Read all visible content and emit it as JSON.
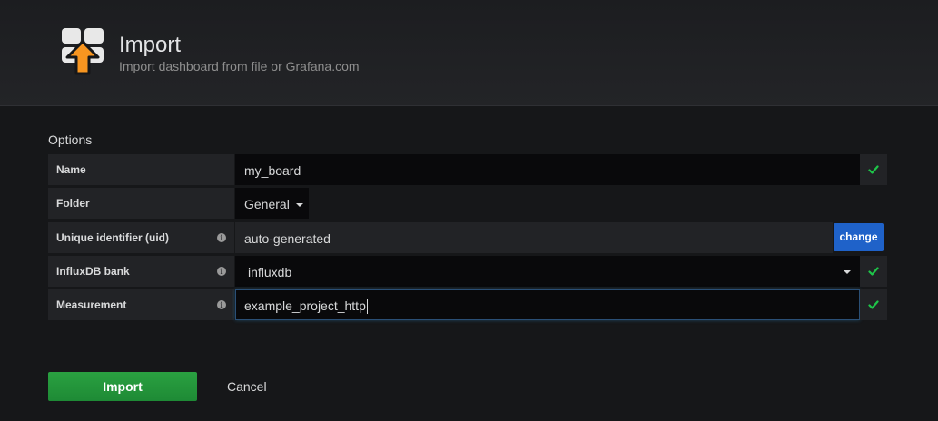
{
  "header": {
    "title": "Import",
    "subtitle": "Import dashboard from file or Grafana.com",
    "icon": "import-dashboard-icon",
    "accent_color": "#f79520"
  },
  "options": {
    "section_title": "Options",
    "name": {
      "label": "Name",
      "value": "my_board",
      "valid": true
    },
    "folder": {
      "label": "Folder",
      "value": "General"
    },
    "uid": {
      "label": "Unique identifier (uid)",
      "value": "auto-generated",
      "change_label": "change"
    },
    "datasource": {
      "label": "InfluxDB bank",
      "value": "influxdb",
      "valid": true
    },
    "measurement": {
      "label": "Measurement",
      "value": "example_project_http",
      "valid": true
    }
  },
  "actions": {
    "import_label": "Import",
    "cancel_label": "Cancel"
  },
  "colors": {
    "success": "#1ec549",
    "primary_button": "#1f62c9",
    "import_button": "#299c3d"
  }
}
